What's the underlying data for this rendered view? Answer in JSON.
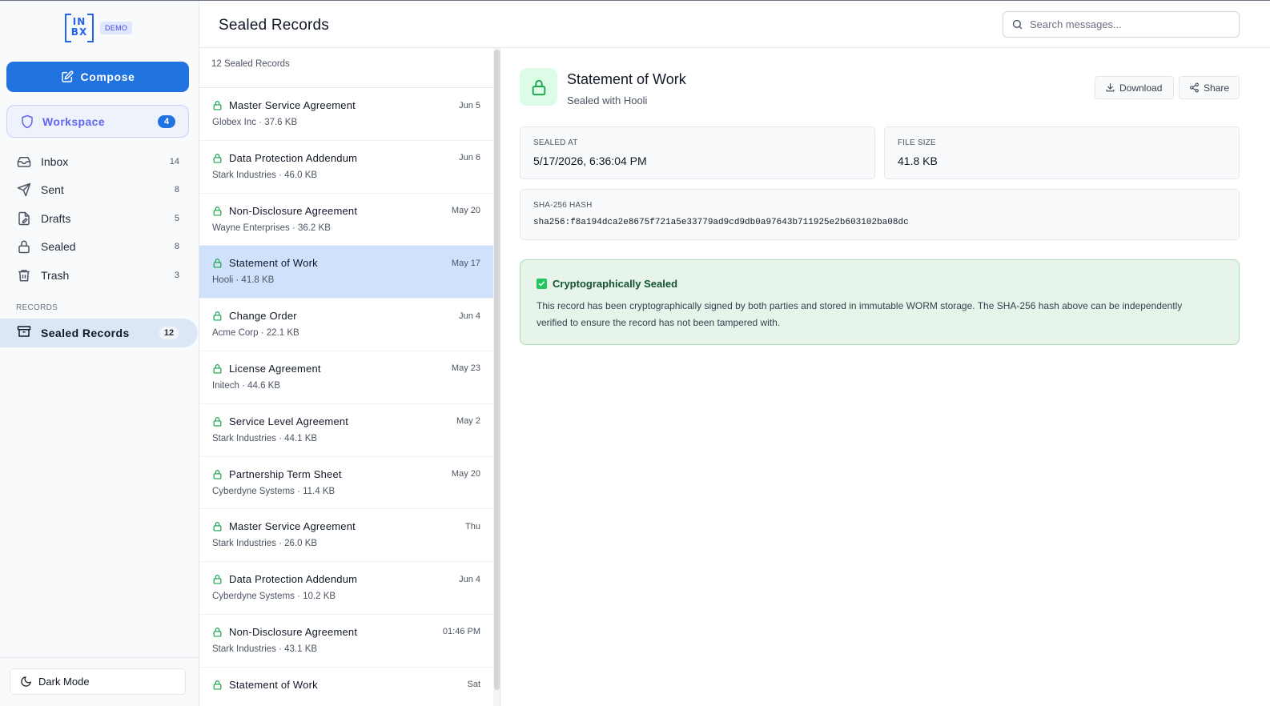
{
  "brand": {
    "logo_text": "IN BX",
    "badge": "DEMO"
  },
  "compose": {
    "label": "Compose"
  },
  "workspace": {
    "label": "Workspace",
    "count": "4"
  },
  "nav": [
    {
      "label": "Inbox",
      "count": "14",
      "icon": "inbox-icon"
    },
    {
      "label": "Sent",
      "count": "8",
      "icon": "send-icon"
    },
    {
      "label": "Drafts",
      "count": "5",
      "icon": "drafts-icon"
    },
    {
      "label": "Sealed",
      "count": "8",
      "icon": "lock-icon"
    },
    {
      "label": "Trash",
      "count": "3",
      "icon": "trash-icon"
    }
  ],
  "records_section": {
    "heading": "RECORDS",
    "item_label": "Sealed Records",
    "item_count": "12"
  },
  "dark_mode": {
    "label": "Dark Mode"
  },
  "header": {
    "title": "Sealed Records",
    "search_placeholder": "Search messages..."
  },
  "list": {
    "count_label": "12 Sealed Records",
    "records": [
      {
        "title": "Master Service Agreement",
        "subtitle": "Globex Inc · 37.6 KB",
        "date": "Jun 5",
        "selected": false
      },
      {
        "title": "Data Protection Addendum",
        "subtitle": "Stark Industries · 46.0 KB",
        "date": "Jun 6",
        "selected": false
      },
      {
        "title": "Non-Disclosure Agreement",
        "subtitle": "Wayne Enterprises · 36.2 KB",
        "date": "May 20",
        "selected": false
      },
      {
        "title": "Statement of Work",
        "subtitle": "Hooli · 41.8 KB",
        "date": "May 17",
        "selected": true
      },
      {
        "title": "Change Order",
        "subtitle": "Acme Corp · 22.1 KB",
        "date": "Jun 4",
        "selected": false
      },
      {
        "title": "License Agreement",
        "subtitle": "Initech · 44.6 KB",
        "date": "May 23",
        "selected": false
      },
      {
        "title": "Service Level Agreement",
        "subtitle": "Stark Industries · 44.1 KB",
        "date": "May 2",
        "selected": false
      },
      {
        "title": "Partnership Term Sheet",
        "subtitle": "Cyberdyne Systems · 11.4 KB",
        "date": "May 20",
        "selected": false
      },
      {
        "title": "Master Service Agreement",
        "subtitle": "Stark Industries · 26.0 KB",
        "date": "Thu",
        "selected": false
      },
      {
        "title": "Data Protection Addendum",
        "subtitle": "Cyberdyne Systems · 10.2 KB",
        "date": "Jun 4",
        "selected": false
      },
      {
        "title": "Non-Disclosure Agreement",
        "subtitle": "Stark Industries · 43.1 KB",
        "date": "01:46 PM",
        "selected": false
      },
      {
        "title": "Statement of Work",
        "subtitle": "",
        "date": "Sat",
        "selected": false
      }
    ]
  },
  "detail": {
    "title": "Statement of Work",
    "subtitle": "Sealed with Hooli",
    "download_label": "Download",
    "share_label": "Share",
    "sealed_at_label": "SEALED AT",
    "sealed_at_value": "5/17/2026, 6:36:04 PM",
    "file_size_label": "FILE SIZE",
    "file_size_value": "41.8 KB",
    "hash_label": "SHA-256 HASH",
    "hash_value": "sha256:f8a194dca2e8675f721a5e33779ad9cd9db0a97643b711925e2b603102ba08dc",
    "verify_title": "Cryptographically Sealed",
    "verify_text": "This record has been cryptographically signed by both parties and stored in immutable WORM storage. The SHA-256 hash above can be independently verified to ensure the record has not been tampered with."
  },
  "colors": {
    "primary": "#2173df",
    "selected_row": "#cfe1fb",
    "success_bg": "#e6f4ea",
    "success_text": "#14532d",
    "lock_green": "#16a34a"
  }
}
